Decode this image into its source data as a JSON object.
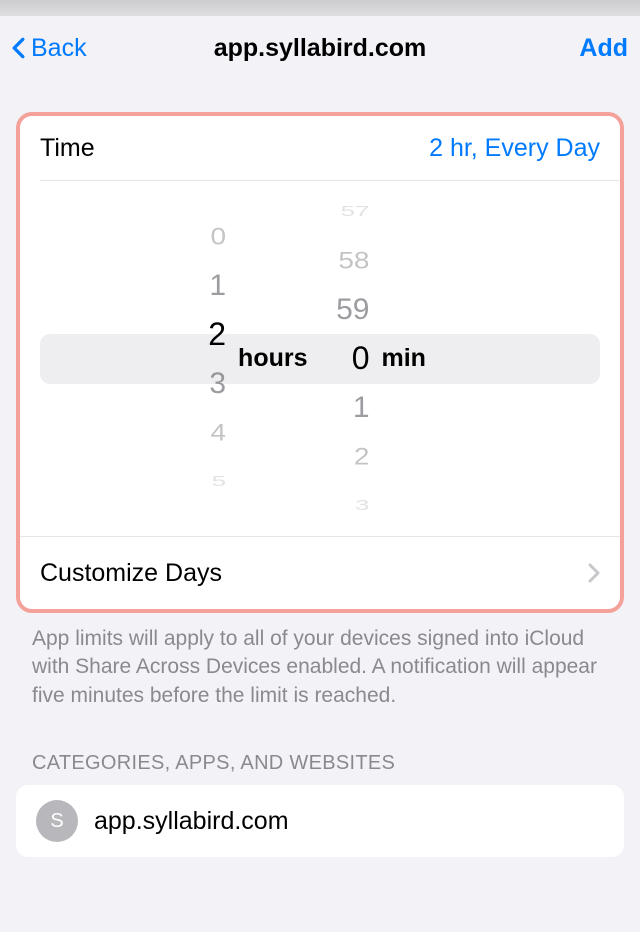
{
  "nav": {
    "back": "Back",
    "title": "app.syllabird.com",
    "add": "Add"
  },
  "time": {
    "label": "Time",
    "value": "2 hr, Every Day"
  },
  "picker": {
    "hours": {
      "selected": "2",
      "unit": "hours",
      "above": [
        "0",
        "1"
      ],
      "below": [
        "3",
        "4",
        "5"
      ]
    },
    "minutes": {
      "selected": "0",
      "unit": "min",
      "above": [
        "57",
        "58",
        "59"
      ],
      "below": [
        "1",
        "2",
        "3"
      ]
    }
  },
  "customize": {
    "label": "Customize Days"
  },
  "help": "App limits will apply to all of your devices signed into iCloud with Share Across Devices enabled. A notification will appear five minutes before the limit is reached.",
  "section_header": "CATEGORIES, APPS, AND WEBSITES",
  "apps": [
    {
      "initial": "S",
      "name": "app.syllabird.com"
    }
  ]
}
